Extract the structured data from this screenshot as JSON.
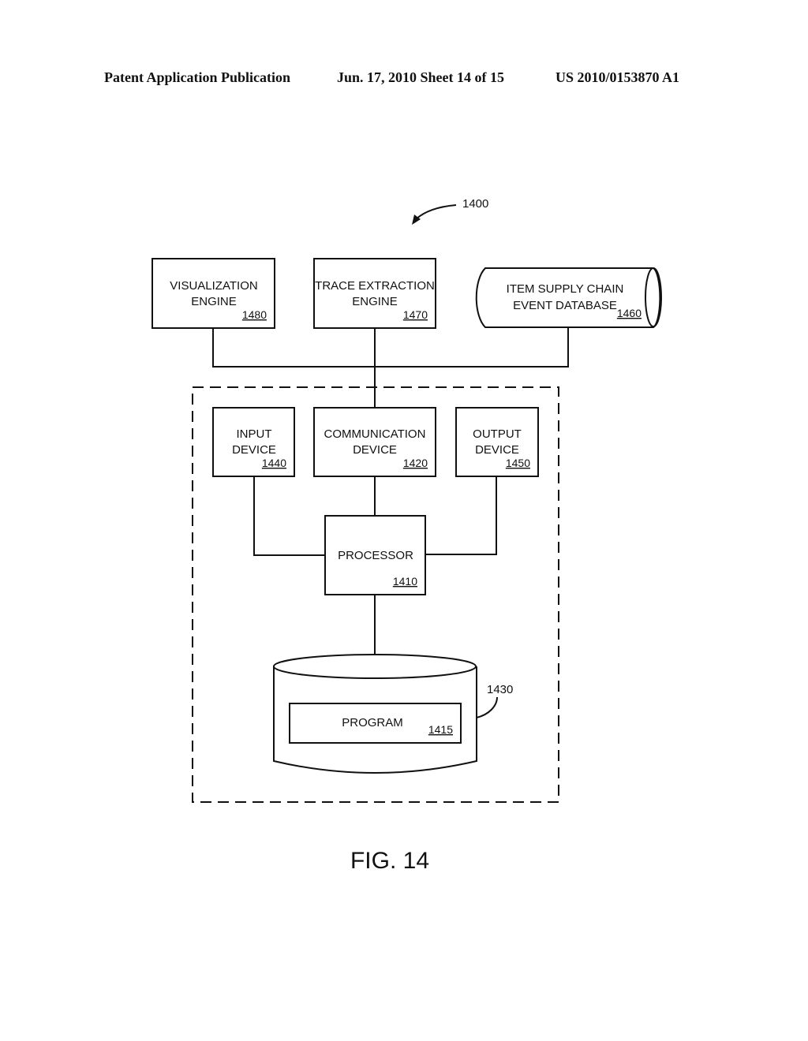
{
  "header": {
    "publication": "Patent Application Publication",
    "date_sheet": "Jun. 17, 2010  Sheet 14 of 15",
    "pub_number": "US 2010/0153870 A1"
  },
  "figure": {
    "ref_overall": "1400",
    "caption": "FIG. 14",
    "nodes": {
      "visualization_engine": {
        "line1": "VISUALIZATION",
        "line2": "ENGINE",
        "ref": "1480"
      },
      "trace_extraction_engine": {
        "line1": "TRACE EXTRACTION",
        "line2": "ENGINE",
        "ref": "1470"
      },
      "event_database": {
        "line1": "ITEM SUPPLY CHAIN",
        "line2": "EVENT DATABASE",
        "ref": "1460"
      },
      "input_device": {
        "line1": "INPUT",
        "line2": "DEVICE",
        "ref": "1440"
      },
      "communication_device": {
        "line1": "COMMUNICATION",
        "line2": "DEVICE",
        "ref": "1420"
      },
      "output_device": {
        "line1": "OUTPUT",
        "line2": "DEVICE",
        "ref": "1450"
      },
      "processor": {
        "line1": "PROCESSOR",
        "ref": "1410"
      },
      "storage": {
        "ref": "1430"
      },
      "program": {
        "line1": "PROGRAM",
        "ref": "1415"
      }
    }
  }
}
